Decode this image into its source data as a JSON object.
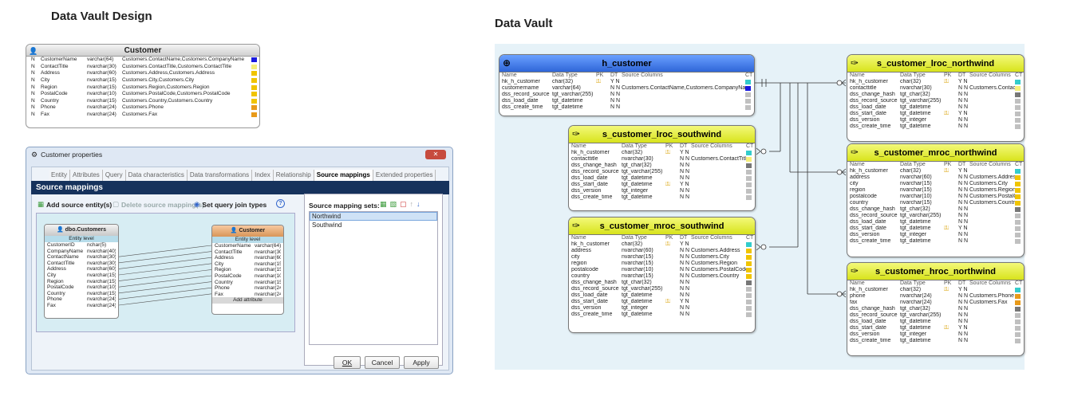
{
  "headings": {
    "left": "Data Vault Design",
    "right": "Data Vault"
  },
  "colors": {
    "cyan": "#33cccc",
    "blue": "#1a1adf",
    "yellow": "#f0c400",
    "light_yellow": "#f6ef7a",
    "orange": "#e89a1a",
    "grey": "#777777",
    "light_grey": "#c0c0c0"
  },
  "design_customer": {
    "title": "Customer",
    "rows": [
      {
        "k": "N",
        "name": "CustomerName",
        "type": "varchar(64)",
        "src": "Customers.ContactName,Customers.CompanyName",
        "color": "#1a1adf"
      },
      {
        "k": "N",
        "name": "ContactTitle",
        "type": "nvarchar(30)",
        "src": "Customers.ContactTitle,Customers.ContactTitle",
        "color": "#f6ef7a"
      },
      {
        "k": "N",
        "name": "Address",
        "type": "nvarchar(60)",
        "src": "Customers.Address,Customers.Address",
        "color": "#f0c400"
      },
      {
        "k": "N",
        "name": "City",
        "type": "nvarchar(15)",
        "src": "Customers.City,Customers.City",
        "color": "#f0c400"
      },
      {
        "k": "N",
        "name": "Region",
        "type": "nvarchar(15)",
        "src": "Customers.Region,Customers.Region",
        "color": "#f0c400"
      },
      {
        "k": "N",
        "name": "PostalCode",
        "type": "nvarchar(10)",
        "src": "Customers.PostalCode,Customers.PostalCode",
        "color": "#f0c400"
      },
      {
        "k": "N",
        "name": "Country",
        "type": "nvarchar(15)",
        "src": "Customers.Country,Customers.Country",
        "color": "#f0c400"
      },
      {
        "k": "N",
        "name": "Phone",
        "type": "nvarchar(24)",
        "src": "Customers.Phone",
        "color": "#e89a1a"
      },
      {
        "k": "N",
        "name": "Fax",
        "type": "nvarchar(24)",
        "src": "Customers.Fax",
        "color": "#e89a1a"
      }
    ]
  },
  "dialog": {
    "title": "Customer properties",
    "tabs": [
      "Entity",
      "Attributes",
      "Query",
      "Data characteristics",
      "Data transformations",
      "Index",
      "Relationship",
      "Source mappings",
      "Extended properties"
    ],
    "section": "Source mappings",
    "toolbar": {
      "add": "Add source entity(s)",
      "delete": "Delete source mapping(s)",
      "join": "Set query join types",
      "help": "?"
    },
    "sets_label": "Source mapping sets:",
    "sets": [
      "Northwind",
      "Southwind"
    ],
    "source_entity": {
      "title": "dbo.Customers",
      "level": "Entity level",
      "rows": [
        [
          "CustomerID",
          "nchar(5)"
        ],
        [
          "CompanyName",
          "nvarchar(40)"
        ],
        [
          "ContactName",
          "nvarchar(30)"
        ],
        [
          "ContactTitle",
          "nvarchar(30)"
        ],
        [
          "Address",
          "nvarchar(60)"
        ],
        [
          "City",
          "nvarchar(15)"
        ],
        [
          "Region",
          "nvarchar(15)"
        ],
        [
          "PostalCode",
          "nvarchar(10)"
        ],
        [
          "Country",
          "nvarchar(15)"
        ],
        [
          "Phone",
          "nvarchar(24)"
        ],
        [
          "Fax",
          "nvarchar(24)"
        ]
      ]
    },
    "target_entity": {
      "title": "Customer",
      "level": "Entity level",
      "add": "Add attribute",
      "rows": [
        [
          "CustomerName",
          "varchar(64)"
        ],
        [
          "ContactTitle",
          "nvarchar(30)"
        ],
        [
          "Address",
          "nvarchar(60)"
        ],
        [
          "City",
          "nvarchar(15)"
        ],
        [
          "Region",
          "nvarchar(15)"
        ],
        [
          "PostalCode",
          "nvarchar(10)"
        ],
        [
          "Country",
          "nvarchar(15)"
        ],
        [
          "Phone",
          "nvarchar(24)"
        ],
        [
          "Fax",
          "nvarchar(24)"
        ]
      ]
    },
    "buttons": {
      "ok": "OK",
      "cancel": "Cancel",
      "apply": "Apply"
    }
  },
  "vault_header": [
    "Name",
    "Data Type",
    "PK",
    "DT",
    "Source Columns",
    "CT"
  ],
  "vault": [
    {
      "id": "h_customer",
      "kind": "hub",
      "title": "h_customer",
      "rows": [
        [
          "hk_h_customer",
          "char(32)",
          "key",
          "Y N",
          "",
          "#33cccc"
        ],
        [
          "customername",
          "varchar(64)",
          "",
          "N N",
          "Customers.ContactName,Customers.CompanyName",
          "#1a1adf"
        ],
        [
          "dss_record_source",
          "tgt_varchar(255)",
          "",
          "N N",
          "",
          "#c0c0c0"
        ],
        [
          "dss_load_date",
          "tgt_datetime",
          "",
          "N N",
          "",
          "#c0c0c0"
        ],
        [
          "dss_create_time",
          "tgt_datetime",
          "",
          "N N",
          "",
          "#c0c0c0"
        ]
      ]
    },
    {
      "id": "s_customer_lroc_northwind",
      "kind": "sat",
      "title": "s_customer_lroc_northwind",
      "rows": [
        [
          "hk_h_customer",
          "char(32)",
          "key",
          "Y N",
          "",
          "#33cccc"
        ],
        [
          "contacttitle",
          "nvarchar(30)",
          "",
          "N N",
          "Customers.ContactTitle",
          "#f6ef7a"
        ],
        [
          "dss_change_hash",
          "tgt_char(32)",
          "",
          "N N",
          "",
          "#777777"
        ],
        [
          "dss_record_source",
          "tgt_varchar(255)",
          "",
          "N N",
          "",
          "#c0c0c0"
        ],
        [
          "dss_load_date",
          "tgt_datetime",
          "",
          "N N",
          "",
          "#c0c0c0"
        ],
        [
          "dss_start_date",
          "tgt_datetime",
          "key",
          "Y N",
          "",
          "#c0c0c0"
        ],
        [
          "dss_version",
          "tgt_integer",
          "",
          "N N",
          "",
          "#c0c0c0"
        ],
        [
          "dss_create_time",
          "tgt_datetime",
          "",
          "N N",
          "",
          "#c0c0c0"
        ]
      ]
    },
    {
      "id": "s_customer_lroc_southwind",
      "kind": "sat",
      "title": "s_customer_lroc_southwind",
      "rows": [
        [
          "hk_h_customer",
          "char(32)",
          "key",
          "Y N",
          "",
          "#33cccc"
        ],
        [
          "contacttitle",
          "nvarchar(30)",
          "",
          "N N",
          "Customers.ContactTitle",
          "#f6ef7a"
        ],
        [
          "dss_change_hash",
          "tgt_char(32)",
          "",
          "N N",
          "",
          "#777777"
        ],
        [
          "dss_record_source",
          "tgt_varchar(255)",
          "",
          "N N",
          "",
          "#c0c0c0"
        ],
        [
          "dss_load_date",
          "tgt_datetime",
          "",
          "N N",
          "",
          "#c0c0c0"
        ],
        [
          "dss_start_date",
          "tgt_datetime",
          "key",
          "Y N",
          "",
          "#c0c0c0"
        ],
        [
          "dss_version",
          "tgt_integer",
          "",
          "N N",
          "",
          "#c0c0c0"
        ],
        [
          "dss_create_time",
          "tgt_datetime",
          "",
          "N N",
          "",
          "#c0c0c0"
        ]
      ]
    },
    {
      "id": "s_customer_mroc_northwind",
      "kind": "sat",
      "title": "s_customer_mroc_northwind",
      "rows": [
        [
          "hk_h_customer",
          "char(32)",
          "key",
          "Y N",
          "",
          "#33cccc"
        ],
        [
          "address",
          "nvarchar(60)",
          "",
          "N N",
          "Customers.Address",
          "#f0c400"
        ],
        [
          "city",
          "nvarchar(15)",
          "",
          "N N",
          "Customers.City",
          "#f0c400"
        ],
        [
          "region",
          "nvarchar(15)",
          "",
          "N N",
          "Customers.Region",
          "#f0c400"
        ],
        [
          "postalcode",
          "nvarchar(10)",
          "",
          "N N",
          "Customers.PostalCode",
          "#f0c400"
        ],
        [
          "country",
          "nvarchar(15)",
          "",
          "N N",
          "Customers.Country",
          "#f0c400"
        ],
        [
          "dss_change_hash",
          "tgt_char(32)",
          "",
          "N N",
          "",
          "#777777"
        ],
        [
          "dss_record_source",
          "tgt_varchar(255)",
          "",
          "N N",
          "",
          "#c0c0c0"
        ],
        [
          "dss_load_date",
          "tgt_datetime",
          "",
          "N N",
          "",
          "#c0c0c0"
        ],
        [
          "dss_start_date",
          "tgt_datetime",
          "key",
          "Y N",
          "",
          "#c0c0c0"
        ],
        [
          "dss_version",
          "tgt_integer",
          "",
          "N N",
          "",
          "#c0c0c0"
        ],
        [
          "dss_create_time",
          "tgt_datetime",
          "",
          "N N",
          "",
          "#c0c0c0"
        ]
      ]
    },
    {
      "id": "s_customer_mroc_southwind",
      "kind": "sat",
      "title": "s_customer_mroc_southwind",
      "rows": [
        [
          "hk_h_customer",
          "char(32)",
          "key",
          "Y N",
          "",
          "#33cccc"
        ],
        [
          "address",
          "nvarchar(60)",
          "",
          "N N",
          "Customers.Address",
          "#f0c400"
        ],
        [
          "city",
          "nvarchar(15)",
          "",
          "N N",
          "Customers.City",
          "#f0c400"
        ],
        [
          "region",
          "nvarchar(15)",
          "",
          "N N",
          "Customers.Region",
          "#f0c400"
        ],
        [
          "postalcode",
          "nvarchar(10)",
          "",
          "N N",
          "Customers.PostalCode",
          "#f0c400"
        ],
        [
          "country",
          "nvarchar(15)",
          "",
          "N N",
          "Customers.Country",
          "#f0c400"
        ],
        [
          "dss_change_hash",
          "tgt_char(32)",
          "",
          "N N",
          "",
          "#777777"
        ],
        [
          "dss_record_source",
          "tgt_varchar(255)",
          "",
          "N N",
          "",
          "#c0c0c0"
        ],
        [
          "dss_load_date",
          "tgt_datetime",
          "",
          "N N",
          "",
          "#c0c0c0"
        ],
        [
          "dss_start_date",
          "tgt_datetime",
          "key",
          "Y N",
          "",
          "#c0c0c0"
        ],
        [
          "dss_version",
          "tgt_integer",
          "",
          "N N",
          "",
          "#c0c0c0"
        ],
        [
          "dss_create_time",
          "tgt_datetime",
          "",
          "N N",
          "",
          "#c0c0c0"
        ]
      ]
    },
    {
      "id": "s_customer_hroc_northwind",
      "kind": "sat",
      "title": "s_customer_hroc_northwind",
      "rows": [
        [
          "hk_h_customer",
          "char(32)",
          "key",
          "Y N",
          "",
          "#33cccc"
        ],
        [
          "phone",
          "nvarchar(24)",
          "",
          "N N",
          "Customers.Phone",
          "#e89a1a"
        ],
        [
          "fax",
          "nvarchar(24)",
          "",
          "N N",
          "Customers.Fax",
          "#e89a1a"
        ],
        [
          "dss_change_hash",
          "tgt_char(32)",
          "",
          "N N",
          "",
          "#777777"
        ],
        [
          "dss_record_source",
          "tgt_varchar(255)",
          "",
          "N N",
          "",
          "#c0c0c0"
        ],
        [
          "dss_load_date",
          "tgt_datetime",
          "",
          "N N",
          "",
          "#c0c0c0"
        ],
        [
          "dss_start_date",
          "tgt_datetime",
          "key",
          "Y N",
          "",
          "#c0c0c0"
        ],
        [
          "dss_version",
          "tgt_integer",
          "",
          "N N",
          "",
          "#c0c0c0"
        ],
        [
          "dss_create_time",
          "tgt_datetime",
          "",
          "N N",
          "",
          "#c0c0c0"
        ]
      ]
    }
  ]
}
